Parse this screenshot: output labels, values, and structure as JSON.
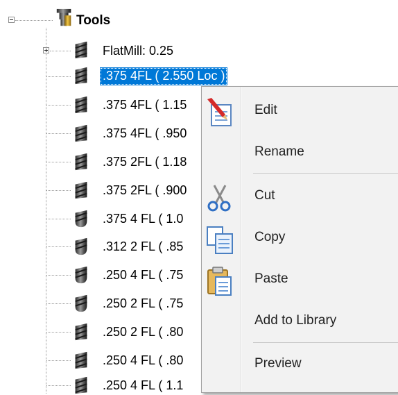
{
  "tree": {
    "root": {
      "label": "Tools",
      "icon": "tool-holder-icon"
    },
    "items": [
      {
        "label": "FlatMill: 0.25",
        "icon": "flat-endmill-icon",
        "expandable": true
      },
      {
        "label": ".375 4FL ( 2.550 Loc )",
        "icon": "flat-endmill-icon",
        "selected": true
      },
      {
        "label": ".375 4FL ( 1.15",
        "icon": "flat-endmill-icon"
      },
      {
        "label": ".375 4FL ( .950",
        "icon": "flat-endmill-icon"
      },
      {
        "label": ".375 2FL ( 1.18",
        "icon": "flat-endmill-icon"
      },
      {
        "label": ".375 2FL ( .900",
        "icon": "flat-endmill-icon"
      },
      {
        "label": ".375 4 FL ( 1.0",
        "icon": "ball-endmill-icon"
      },
      {
        "label": ".312 2 FL ( .85",
        "icon": "ball-endmill-icon"
      },
      {
        "label": ".250 4 FL ( .75",
        "icon": "ball-endmill-icon"
      },
      {
        "label": ".250 2 FL ( .75",
        "icon": "ball-endmill-icon"
      },
      {
        "label": ".250 2 FL ( .80",
        "icon": "flat-endmill-icon"
      },
      {
        "label": ".250 4 FL ( .80",
        "icon": "flat-endmill-icon"
      },
      {
        "label": ".250 4 FL ( 1.1",
        "icon": "flat-endmill-icon"
      }
    ]
  },
  "context_menu": {
    "items": [
      {
        "label": "Edit",
        "icon": "edit-pencil-icon"
      },
      {
        "label": "Rename",
        "icon": ""
      },
      {
        "label": "Cut",
        "icon": "scissors-icon"
      },
      {
        "label": "Copy",
        "icon": "copy-icon"
      },
      {
        "label": "Paste",
        "icon": "clipboard-paste-icon"
      },
      {
        "label": "Add to Library",
        "icon": ""
      },
      {
        "label": "Preview",
        "icon": ""
      }
    ]
  },
  "colors": {
    "selection": "#0078d7",
    "menu_background": "#f2f2f2",
    "menu_border": "#a0a0a0"
  }
}
